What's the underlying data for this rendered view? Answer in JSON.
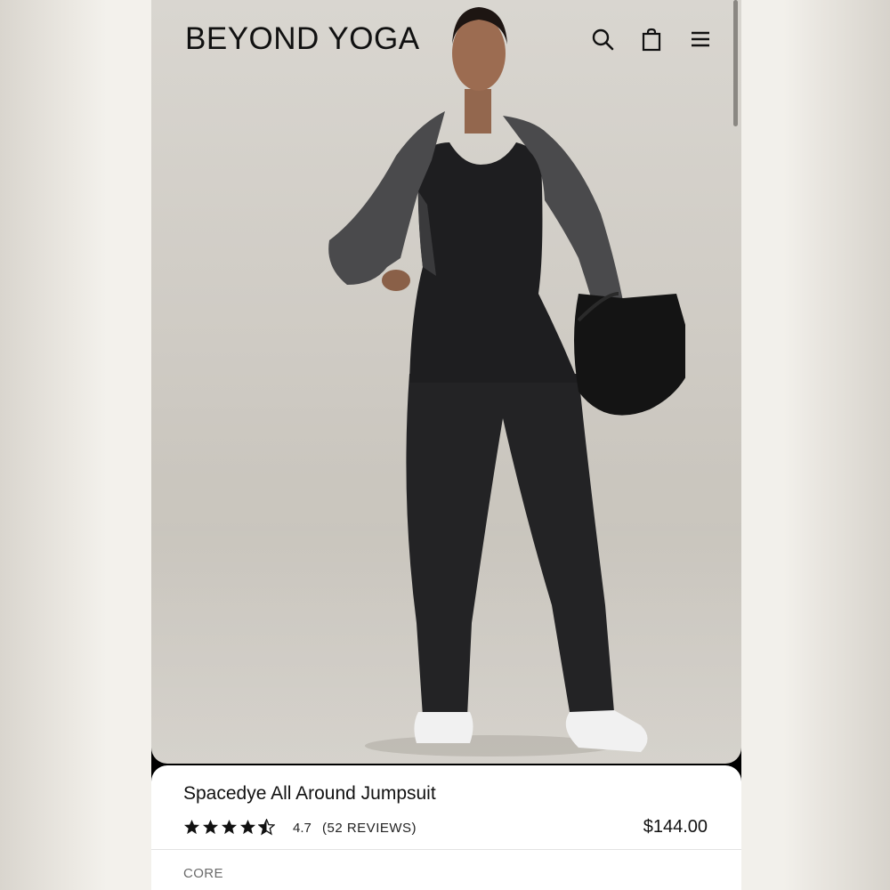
{
  "header": {
    "brand": "BEYOND YOGA",
    "icons": [
      "search-icon",
      "shopping-bag-icon",
      "menu-icon"
    ]
  },
  "product": {
    "name": "Spacedye All Around Jumpsuit",
    "rating": 4.7,
    "rating_label": "4.7",
    "stars_filled": 4.5,
    "reviews_label": "(52 REVIEWS)",
    "price": "$144.00",
    "collection": "CORE"
  },
  "colors": {
    "text": "#111111",
    "muted": "#6a6a6a",
    "background": "#ffffff"
  }
}
